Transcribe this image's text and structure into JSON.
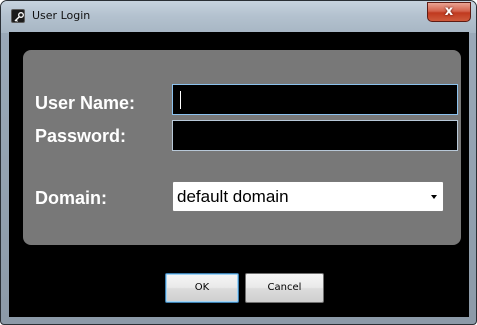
{
  "window": {
    "title": "User Login",
    "close_label": "x"
  },
  "form": {
    "username_label": "User Name:",
    "username_value": "",
    "password_label": "Password:",
    "password_value": "",
    "domain_label": "Domain:",
    "domain_value": "default domain"
  },
  "buttons": {
    "ok_label": "OK",
    "cancel_label": "Cancel"
  },
  "icons": {
    "app": "key-icon",
    "close": "close-icon",
    "dropdown": "chevron-down-icon"
  },
  "colors": {
    "panel": "#787878",
    "client_background": "#000000",
    "label_text": "#ffffff",
    "close_button": "#c0391f",
    "focus_border": "#8cc2ee"
  }
}
